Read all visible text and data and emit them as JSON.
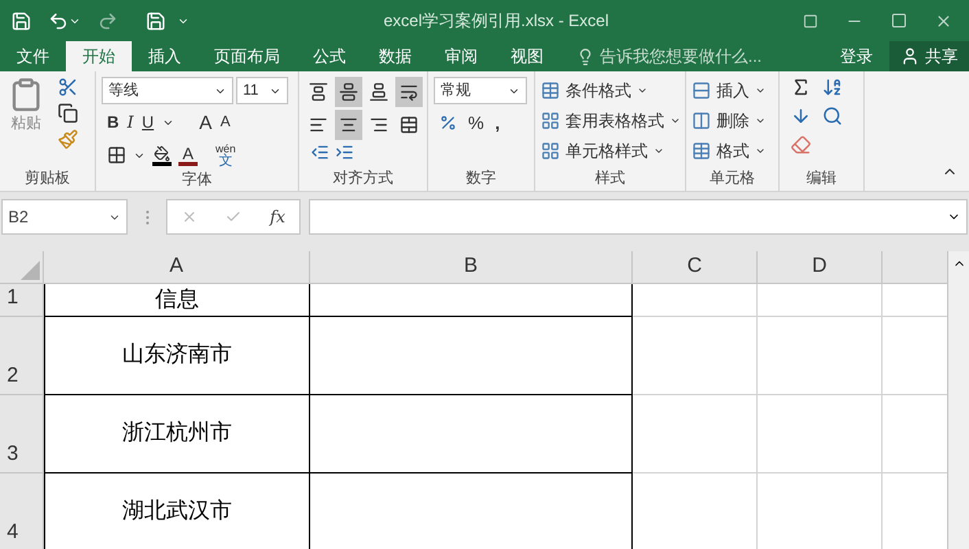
{
  "window": {
    "title": "excel学习案例引用.xlsx - Excel"
  },
  "tabs": [
    {
      "label": "文件",
      "selected": false
    },
    {
      "label": "开始",
      "selected": true
    },
    {
      "label": "插入",
      "selected": false
    },
    {
      "label": "页面布局",
      "selected": false
    },
    {
      "label": "公式",
      "selected": false
    },
    {
      "label": "数据",
      "selected": false
    },
    {
      "label": "审阅",
      "selected": false
    },
    {
      "label": "视图",
      "selected": false
    }
  ],
  "tell_me": {
    "placeholder": "告诉我您想要做什么..."
  },
  "sign_in": "登录",
  "share": "共享",
  "ribbon": {
    "clipboard": {
      "paste": "粘贴",
      "label": "剪贴板"
    },
    "font": {
      "name": "等线",
      "size": "11",
      "bold": "B",
      "italic": "I",
      "underline": "U",
      "grow": "A",
      "shrink": "A",
      "font_color": "A",
      "phonetic_top": "wén",
      "phonetic_bottom": "文",
      "label": "字体"
    },
    "alignment": {
      "buttons": [
        {
          "kind": "align-top",
          "selected": false
        },
        {
          "kind": "align-middle",
          "selected": true
        },
        {
          "kind": "align-bottom",
          "selected": false
        },
        {
          "kind": "wrap",
          "selected": true
        },
        {
          "kind": "align-left",
          "selected": false
        },
        {
          "kind": "align-center",
          "selected": true
        },
        {
          "kind": "align-right",
          "selected": false
        },
        {
          "kind": "merge",
          "selected": false
        }
      ],
      "label": "对齐方式"
    },
    "number": {
      "format": "常规",
      "percent": "%",
      "comma": ",",
      "label": "数字"
    },
    "styles": {
      "items": [
        "条件格式",
        "套用表格格式",
        "单元格样式"
      ],
      "label": "样式"
    },
    "cells": {
      "items": [
        "插入",
        "删除",
        "格式"
      ],
      "label": "单元格"
    },
    "editing": {
      "label": "编辑"
    }
  },
  "formula_bar": {
    "name_box": "B2",
    "fx": "fx"
  },
  "sheet": {
    "columns": [
      "A",
      "B",
      "C",
      "D"
    ],
    "rows": [
      {
        "number": "1",
        "value": "信息"
      },
      {
        "number": "2",
        "value": "山东济南市"
      },
      {
        "number": "3",
        "value": "浙江杭州市"
      },
      {
        "number": "4",
        "value": "湖北武汉市"
      }
    ]
  }
}
